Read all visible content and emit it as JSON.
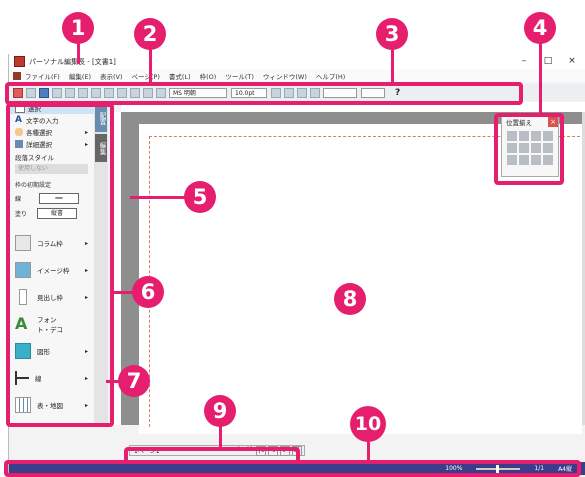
{
  "window": {
    "title": "パーソナル編集長 - [文書1]",
    "min": "–",
    "max": "□",
    "close": "×"
  },
  "menu": [
    "ファイル(F)",
    "編集(E)",
    "表示(V)",
    "ページ(P)",
    "書式(L)",
    "枠(O)",
    "ツール(T)",
    "ウィンドウ(W)",
    "ヘルプ(H)"
  ],
  "toolbar": {
    "font": "MS 明朝",
    "size": "10.0pt",
    "help": "?"
  },
  "sidebar": {
    "select": "選択",
    "text_input": "文字の入力",
    "various_select": "各種選択",
    "detail_select": "詳細選択",
    "para_style_label": "段落スタイル",
    "para_style_value": "使用しない",
    "frame_initial": "枠の初期設定",
    "line_label": "線",
    "fill_label": "塗り",
    "fill_value": "縦書",
    "column_frame": "コラム枠",
    "image_frame": "イメージ枠",
    "heading_frame": "見出し枠",
    "font_deco": "フォント・デコ",
    "shape": "図形",
    "line": "線",
    "table_map": "表・地図"
  },
  "vtabs": [
    "配置",
    "編集"
  ],
  "palette": {
    "title": "位置揃え"
  },
  "pagebar": {
    "label": "1ページ1",
    "pages": "ページ"
  },
  "status": {
    "zoom": "100%",
    "pages": "1/1",
    "paper": "A4縦"
  },
  "callouts": [
    "1",
    "2",
    "3",
    "4",
    "5",
    "6",
    "7",
    "8",
    "9",
    "10"
  ],
  "colors": {
    "accent": "#e61e6e",
    "statusbar": "#3b3d8a"
  }
}
